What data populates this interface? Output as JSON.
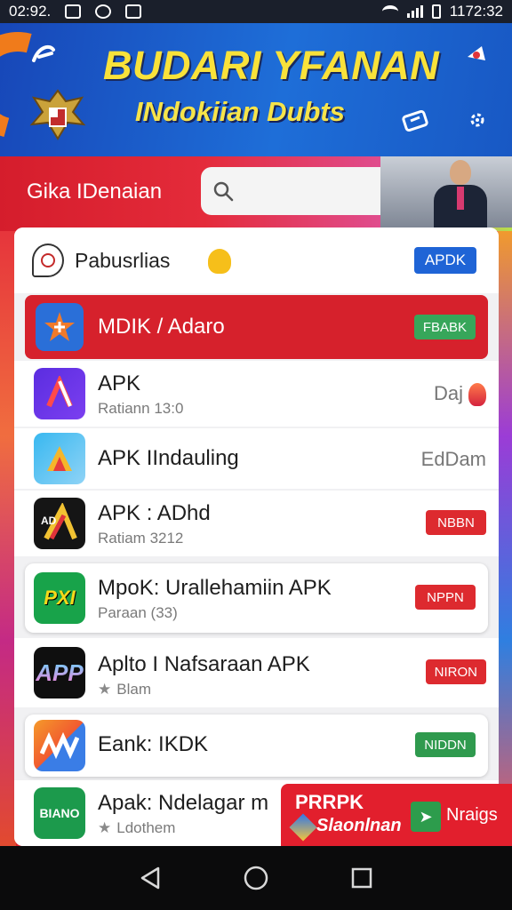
{
  "status_bar": {
    "time": "02:92.",
    "right_time": "1172:32"
  },
  "banner": {
    "title": "BUDARI YFANAN",
    "subtitle": "INdokiian Dubts"
  },
  "search": {
    "label": "Gika IDenaian",
    "placeholder": ""
  },
  "card": {
    "header": {
      "title": "Pabusrlias",
      "badge": "APDK"
    },
    "apps": [
      {
        "name": "MDIK / Adaro",
        "tag": "FBABK",
        "tag_color": "#37a65a",
        "highlighted": true
      },
      {
        "name": "APK",
        "sub": "Ratiann 13:0",
        "right_text": "Daj",
        "icon": "flame-icon"
      },
      {
        "name": "APK IIndauling",
        "right_text": "EdDam"
      },
      {
        "name": "APK : ADhd",
        "sub": "Ratiam 3212",
        "tag": "NBBN",
        "tag_color": "#dd2a2f"
      },
      {
        "name": "MpoK: Urallehamiin APK",
        "sub": "Paraan (33)",
        "tag": "NPPN",
        "tag_color": "#dd2a2f",
        "icon_text": "PXI"
      },
      {
        "name": "Aplto I Nafsaraan APK",
        "sub": "Blam",
        "sub_star": true,
        "tag": "NIRON",
        "tag_color": "#dd2a2f",
        "icon_text": "APP"
      },
      {
        "name": "Eank: IKDK",
        "tag": "NIDDN",
        "tag_color": "#2f9a4e"
      },
      {
        "name": "Apak: Ndelagar m",
        "sub": "Ldothem",
        "sub_star": true,
        "icon_text": "BIANO"
      }
    ]
  },
  "promo": {
    "title": "PRRPK",
    "subtitle": "Slaonlnan",
    "right": "Nraigs"
  }
}
